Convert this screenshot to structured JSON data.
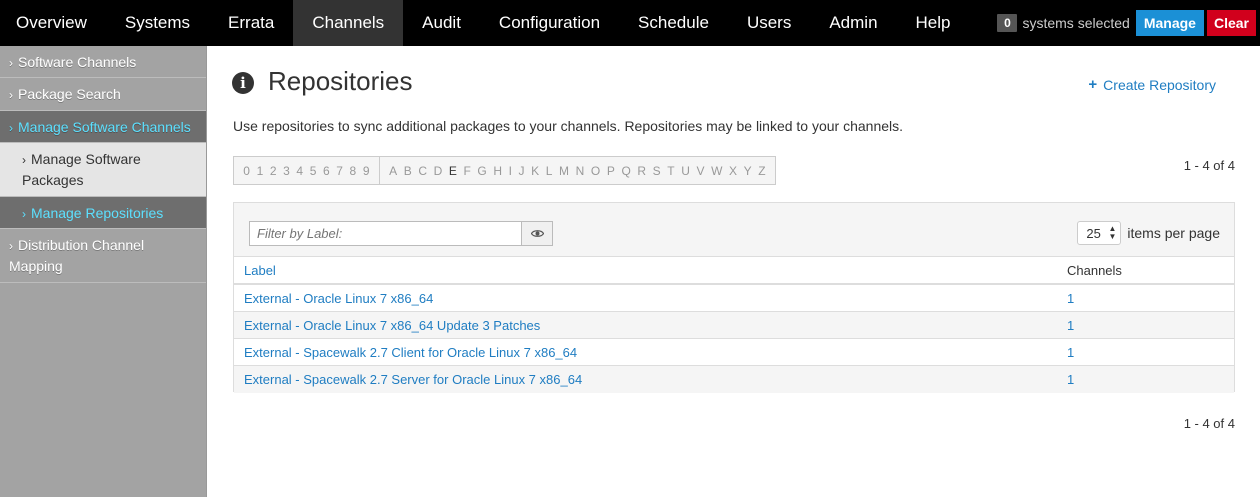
{
  "topnav": {
    "items": [
      {
        "label": "Overview",
        "active": false
      },
      {
        "label": "Systems",
        "active": false
      },
      {
        "label": "Errata",
        "active": false
      },
      {
        "label": "Channels",
        "active": true
      },
      {
        "label": "Audit",
        "active": false
      },
      {
        "label": "Configuration",
        "active": false
      },
      {
        "label": "Schedule",
        "active": false
      },
      {
        "label": "Users",
        "active": false
      },
      {
        "label": "Admin",
        "active": false
      },
      {
        "label": "Help",
        "active": false
      }
    ],
    "systems_count": "0",
    "systems_text": "systems selected",
    "manage_label": "Manage",
    "clear_label": "Clear"
  },
  "sidebar": {
    "items": [
      {
        "label": "Software Channels"
      },
      {
        "label": "Package Search"
      },
      {
        "label": "Manage Software Channels"
      },
      {
        "label": "Manage Software Packages"
      },
      {
        "label": "Manage Repositories"
      },
      {
        "label": "Distribution Channel Mapping"
      }
    ]
  },
  "main": {
    "title": "Repositories",
    "create_label": "Create Repository",
    "description": "Use repositories to sync additional packages to your channels. Repositories may be linked to your channels.",
    "alpha_digits": [
      "0",
      "1",
      "2",
      "3",
      "4",
      "5",
      "6",
      "7",
      "8",
      "9"
    ],
    "alpha_letters": [
      "A",
      "B",
      "C",
      "D",
      "E",
      "F",
      "G",
      "H",
      "I",
      "J",
      "K",
      "L",
      "M",
      "N",
      "O",
      "P",
      "Q",
      "R",
      "S",
      "T",
      "U",
      "V",
      "W",
      "X",
      "Y",
      "Z"
    ],
    "alpha_active": "E",
    "count_top": "1 - 4 of 4",
    "count_bottom": "1 - 4 of 4",
    "filter_placeholder": "Filter by Label:",
    "per_page_value": "25",
    "per_page_label": "items per page",
    "table": {
      "columns": [
        "Label",
        "Channels"
      ],
      "rows": [
        {
          "label": "External - Oracle Linux 7 x86_64",
          "channels": "1"
        },
        {
          "label": "External - Oracle Linux 7 x86_64 Update 3 Patches",
          "channels": "1"
        },
        {
          "label": "External - Spacewalk 2.7 Client for Oracle Linux 7 x86_64",
          "channels": "1"
        },
        {
          "label": "External - Spacewalk 2.7 Server for Oracle Linux 7 x86_64",
          "channels": "1"
        }
      ]
    }
  },
  "colors": {
    "accent": "#1f7dc2",
    "manage_button": "#1b90d6",
    "clear_button": "#d1001c",
    "sidebar_active_text": "#5ce0ff"
  },
  "icons": {
    "title_icon": "info-circle-icon",
    "create_icon": "plus-icon",
    "filter_icon": "eye-icon",
    "sidebar_icon": "chevron-right-icon"
  }
}
